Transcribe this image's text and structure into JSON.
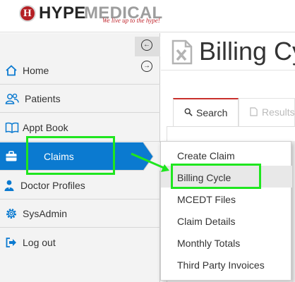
{
  "header": {
    "logo_mark": "H",
    "brand_primary": "HYPE",
    "brand_secondary": "MEDICAL",
    "tagline": "We live up to the hype!"
  },
  "sidebar": {
    "items": [
      {
        "label": "Home",
        "icon": "home-icon"
      },
      {
        "label": "Patients",
        "icon": "users-icon"
      },
      {
        "label": "Appt Book",
        "icon": "book-icon"
      },
      {
        "label": "Claims",
        "icon": "briefcase-icon",
        "active": true
      },
      {
        "label": "Doctor Profiles",
        "icon": "doctor-icon"
      },
      {
        "label": "SysAdmin",
        "icon": "gear-icon"
      },
      {
        "label": "Log out",
        "icon": "logout-icon"
      }
    ]
  },
  "main": {
    "page_title": "Billing Cycle",
    "tabs": [
      {
        "label": "Search",
        "icon": "search-icon",
        "active": true
      },
      {
        "label": "Results",
        "icon": "document-icon"
      }
    ]
  },
  "dropdown": {
    "items": [
      {
        "label": "Create Claim"
      },
      {
        "label": "Billing Cycle",
        "highlighted": true
      },
      {
        "label": "MCEDT Files"
      },
      {
        "label": "Claim Details"
      },
      {
        "label": "Monthly Totals"
      },
      {
        "label": "Third Party Invoices"
      }
    ]
  },
  "colors": {
    "accent_blue": "#0b7ad0",
    "brand_red": "#b41f24",
    "annotation_green": "#1fe61f",
    "tab_active_border": "#c9302c"
  }
}
